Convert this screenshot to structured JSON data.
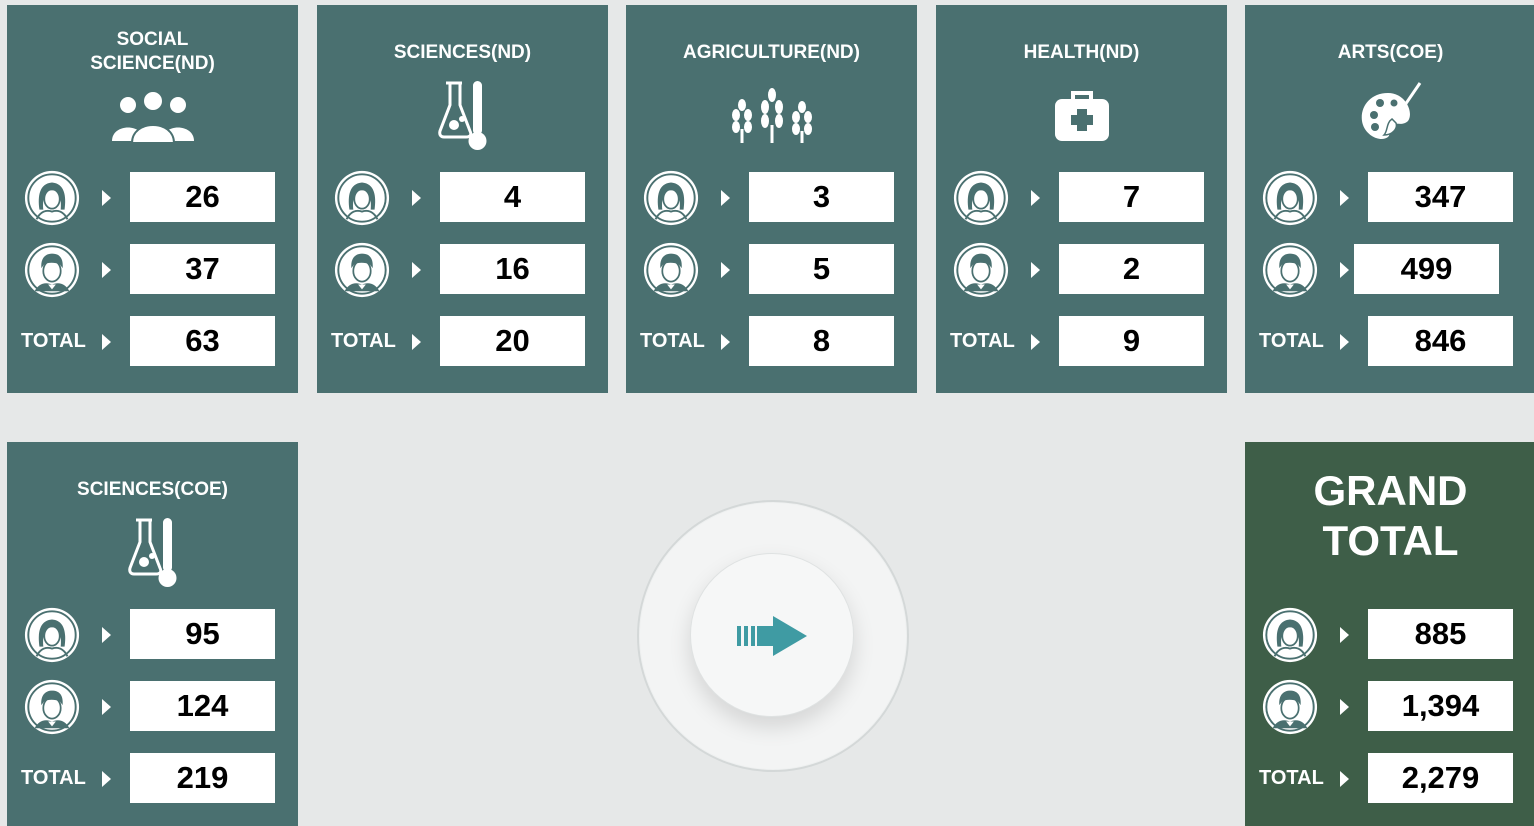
{
  "colors": {
    "card": "#4a7070",
    "grand_card": "#3e5e48",
    "background": "#e6e8e8",
    "accent_arrow": "#3f9ba3"
  },
  "row_labels": {
    "total": "TOTAL"
  },
  "icons": {
    "female": "female-avatar-icon",
    "male": "male-avatar-icon"
  },
  "cards": [
    {
      "title": "SOCIAL\nSCIENCE(ND)",
      "icon": "people-group-icon",
      "female": "26",
      "male": "37",
      "total": "63"
    },
    {
      "title": "SCIENCES(ND)",
      "icon": "flask-thermometer-icon",
      "female": "4",
      "male": "16",
      "total": "20"
    },
    {
      "title": "AGRICULTURE(ND)",
      "icon": "wheat-icon",
      "female": "3",
      "male": "5",
      "total": "8"
    },
    {
      "title": "HEALTH(ND)",
      "icon": "first-aid-kit-icon",
      "female": "7",
      "male": "2",
      "total": "9"
    },
    {
      "title": "ARTS(COE)",
      "icon": "palette-brush-icon",
      "female": "347",
      "male": "499",
      "total": "846"
    },
    {
      "title": "SCIENCES(COE)",
      "icon": "flask-thermometer-icon",
      "female": "95",
      "male": "124",
      "total": "219"
    }
  ],
  "grand": {
    "title": "GRAND\nTOTAL",
    "female": "885",
    "male": "1,394",
    "total": "2,279"
  },
  "center_button": {
    "icon": "next-arrow-icon"
  }
}
